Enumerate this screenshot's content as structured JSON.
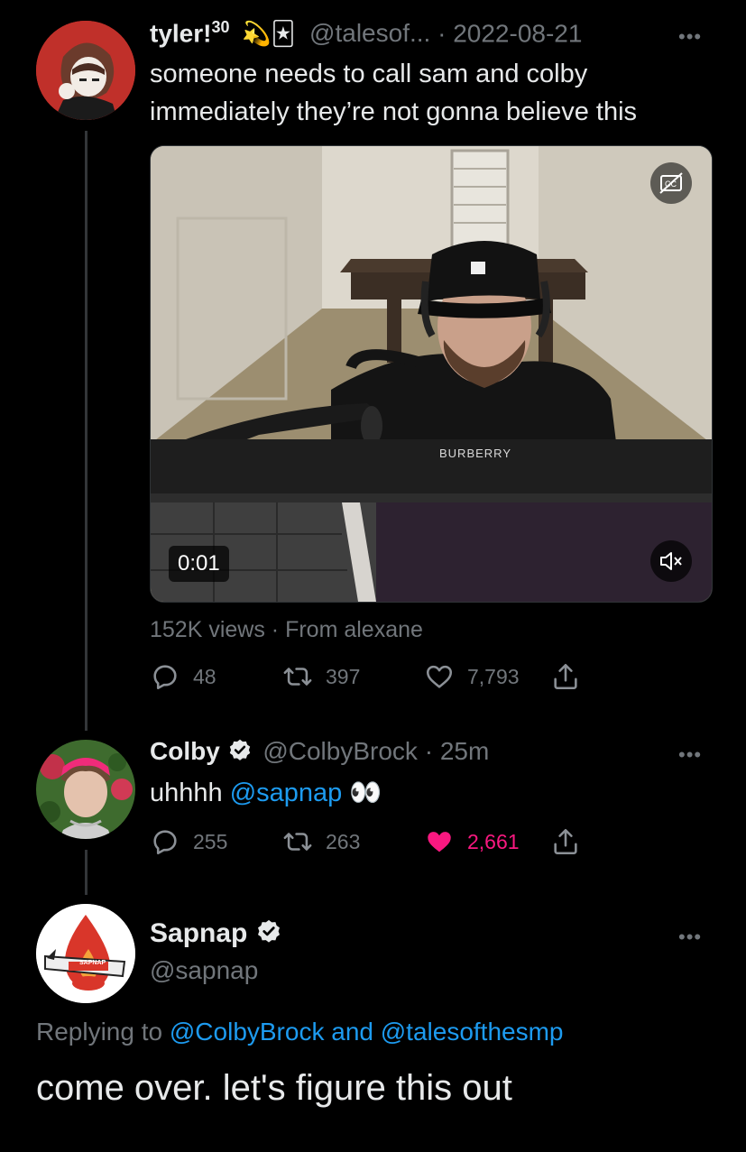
{
  "tweet1": {
    "name": "tyler!",
    "superscript": "30",
    "emoji": "💫🃏",
    "handle": "@talesof...",
    "separator": " · ",
    "date": "2022-08-21",
    "text": "someone needs to call sam and colby immediately they’re not gonna believe this",
    "video": {
      "timestamp": "0:01",
      "shirt_text": "BURBERRY",
      "cap_logo": "☒"
    },
    "views": "152K views",
    "source": " · From alexane",
    "replies": "48",
    "retweets": "397",
    "likes": "7,793"
  },
  "tweet2": {
    "name": "Colby",
    "handle": "@ColbyBrock",
    "separator": " · ",
    "time": "25m",
    "text_prefix": "uhhhh ",
    "mention": "@sapnap",
    "emoji": "👀",
    "replies": "255",
    "retweets": "263",
    "likes": "2,661"
  },
  "tweet3": {
    "name": "Sapnap",
    "handle": "@sapnap",
    "logo_text": "SAPNAP",
    "replying_prefix": "Replying to ",
    "reply_to_1": "@ColbyBrock",
    "reply_and": " and ",
    "reply_to_2": "@talesofthesmp",
    "text": "come over. let's figure this out"
  },
  "more_label": "•••",
  "colors": {
    "background": "#000000",
    "text": "#e7e9ea",
    "muted": "#71767b",
    "link": "#1d9bf0",
    "like_active": "#f91880"
  },
  "icons": [
    "reply-icon",
    "retweet-icon",
    "like-icon",
    "share-icon",
    "verified-icon",
    "captions-icon",
    "mute-icon"
  ]
}
